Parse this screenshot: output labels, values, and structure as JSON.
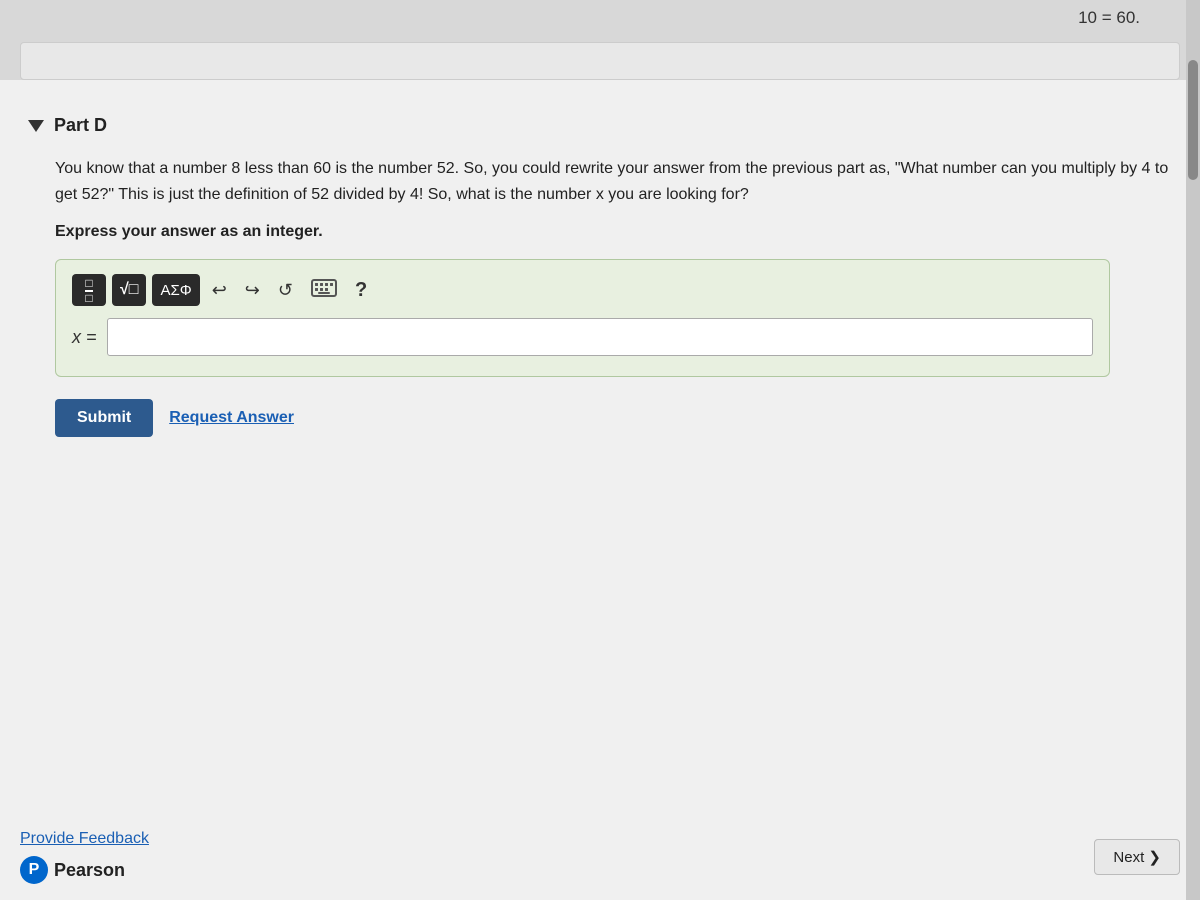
{
  "top": {
    "equation_display": "10 = 60."
  },
  "part": {
    "label": "Part D"
  },
  "question": {
    "paragraph": "You know that a number 8 less than 60 is the number 52. So, you could rewrite your answer from the previous part as, \"What number can you multiply by 4 to get 52?\" This is just the definition of 52 divided by 4! So, what is the number x you are looking for?",
    "instruction": "Express your answer as an integer."
  },
  "toolbar": {
    "sqrt_label": "√□",
    "greek_label": "ΑΣΦ",
    "undo_symbol": "↩",
    "redo_symbol": "↪",
    "refresh_symbol": "↺",
    "help_symbol": "?"
  },
  "answer": {
    "variable_label": "x =",
    "input_placeholder": ""
  },
  "actions": {
    "submit_label": "Submit",
    "request_answer_label": "Request Answer"
  },
  "footer": {
    "feedback_label": "Provide Feedback",
    "pearson_icon": "P",
    "pearson_name": "Pearson",
    "next_label": "Next ❯"
  }
}
